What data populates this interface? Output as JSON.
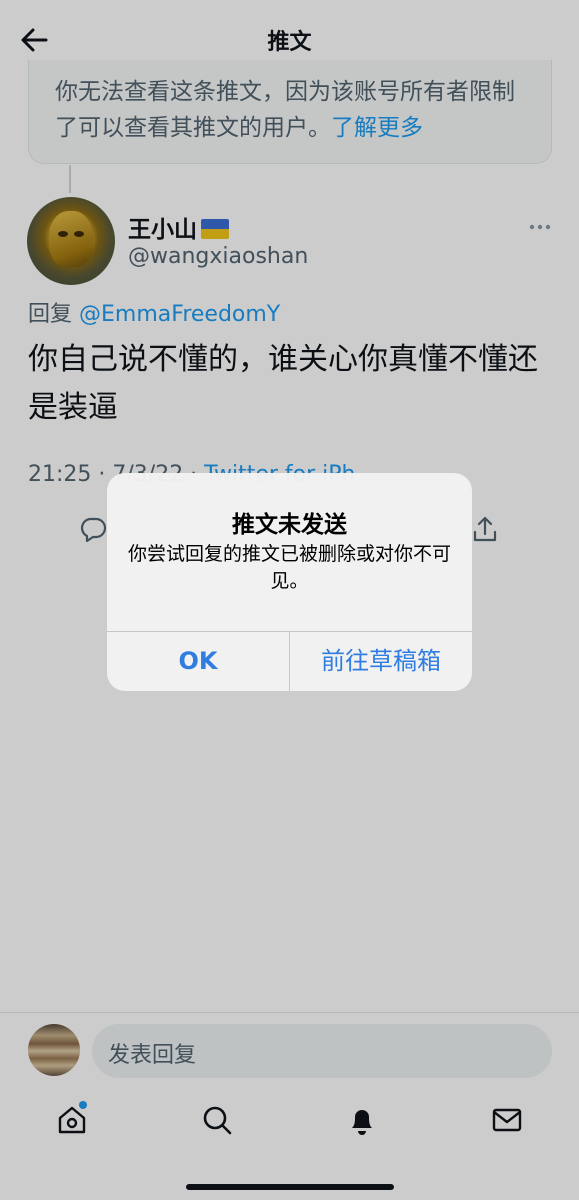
{
  "header": {
    "title": "推文"
  },
  "restricted_notice": {
    "text": "你无法查看这条推文，因为该账号所有者限制了可以查看其推文的用户。",
    "link": "了解更多"
  },
  "tweet": {
    "author_name": "王小山",
    "author_handle": "@wangxiaoshan",
    "reply_prefix": "回复",
    "reply_to": "@EmmaFreedomY",
    "text": "你自己说不懂的，谁关心你真懂不懂还是装逼",
    "timestamp": "21:25 · 7/3/22 · ",
    "source": "Twitter for iPh"
  },
  "composer": {
    "placeholder": "发表回复"
  },
  "alert": {
    "title": "推文未发送",
    "message": "你尝试回复的推文已被删除或对你不可见。",
    "ok_label": "OK",
    "drafts_label": "前往草稿箱"
  },
  "icons": {
    "back": "arrow-left-icon",
    "more": "more-icon",
    "reply": "reply-icon",
    "share": "share-icon",
    "home": "home-icon",
    "search": "search-icon",
    "notifications": "bell-icon",
    "messages": "mail-icon"
  },
  "colors": {
    "accent": "#1d9bf0",
    "alert_button": "#2f7de1",
    "text_secondary": "#536471"
  }
}
